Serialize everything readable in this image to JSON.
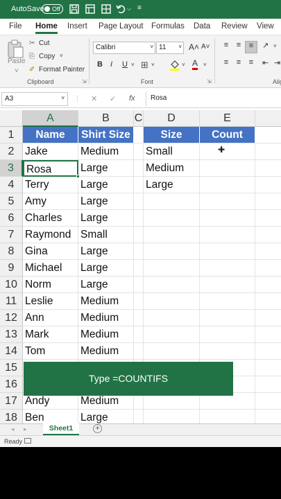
{
  "titlebar": {
    "autosave_label": "AutoSave",
    "toggle_state": "Off",
    "icons": [
      "save-icon",
      "grid-icon",
      "undo-icon",
      "more-icon"
    ]
  },
  "menu": {
    "tabs": [
      {
        "label": "File"
      },
      {
        "label": "Home"
      },
      {
        "label": "Insert"
      },
      {
        "label": "Page Layout"
      },
      {
        "label": "Formulas"
      },
      {
        "label": "Data"
      },
      {
        "label": "Review"
      },
      {
        "label": "View"
      }
    ],
    "active": "Home"
  },
  "ribbon": {
    "paste_label": "Paste",
    "cut_label": "Cut",
    "copy_label": "Copy",
    "format_painter_label": "Format Painter",
    "clipboard_group": "Clipboard",
    "font_name": "Calibri",
    "font_size": "11",
    "font_group": "Font",
    "alignment_group": "Alig",
    "bold": "B",
    "italic": "I",
    "underline": "U",
    "grow_font": "A˄",
    "shrink_font": "A˅",
    "font_color_letter": "A",
    "highlight_color": "#ffff00",
    "font_color": "#e00000"
  },
  "formula_bar": {
    "name_box": "A3",
    "cancel": "✕",
    "enter": "✓",
    "fx": "fx",
    "value": "Rosa"
  },
  "grid": {
    "columns": [
      "A",
      "B",
      "C",
      "D",
      "E"
    ],
    "active_column": "A",
    "rows": [
      "1",
      "2",
      "3",
      "4",
      "5",
      "6",
      "7",
      "8",
      "9",
      "10",
      "11",
      "12",
      "13",
      "14",
      "15",
      "16",
      "17",
      "18"
    ],
    "active_row": "3",
    "header_fill": "#4472c4",
    "names": [
      "Name",
      "Jake",
      "Rosa",
      "Terry",
      "Amy",
      "Charles",
      "Raymond",
      "Gina",
      "Michael",
      "Norm",
      "Leslie",
      "Ann",
      "Mark",
      "Tom",
      "",
      "",
      "Andy",
      "Ben"
    ],
    "shirt_sizes": [
      "Shirt Size",
      "Medium",
      "Large",
      "Large",
      "Large",
      "Large",
      "Small",
      "Large",
      "Large",
      "Large",
      "Medium",
      "Medium",
      "Medium",
      "Medium",
      "",
      "",
      "Medium",
      "Large"
    ],
    "sizes": [
      "Size",
      "Small",
      "Medium",
      "Large"
    ],
    "counts": [
      "Count"
    ]
  },
  "banner": {
    "text": "Type =COUNTIFS",
    "color": "#217346"
  },
  "sheets": {
    "tabs": [
      "Sheet1"
    ],
    "active": "Sheet1"
  },
  "status": {
    "text": "Ready"
  }
}
